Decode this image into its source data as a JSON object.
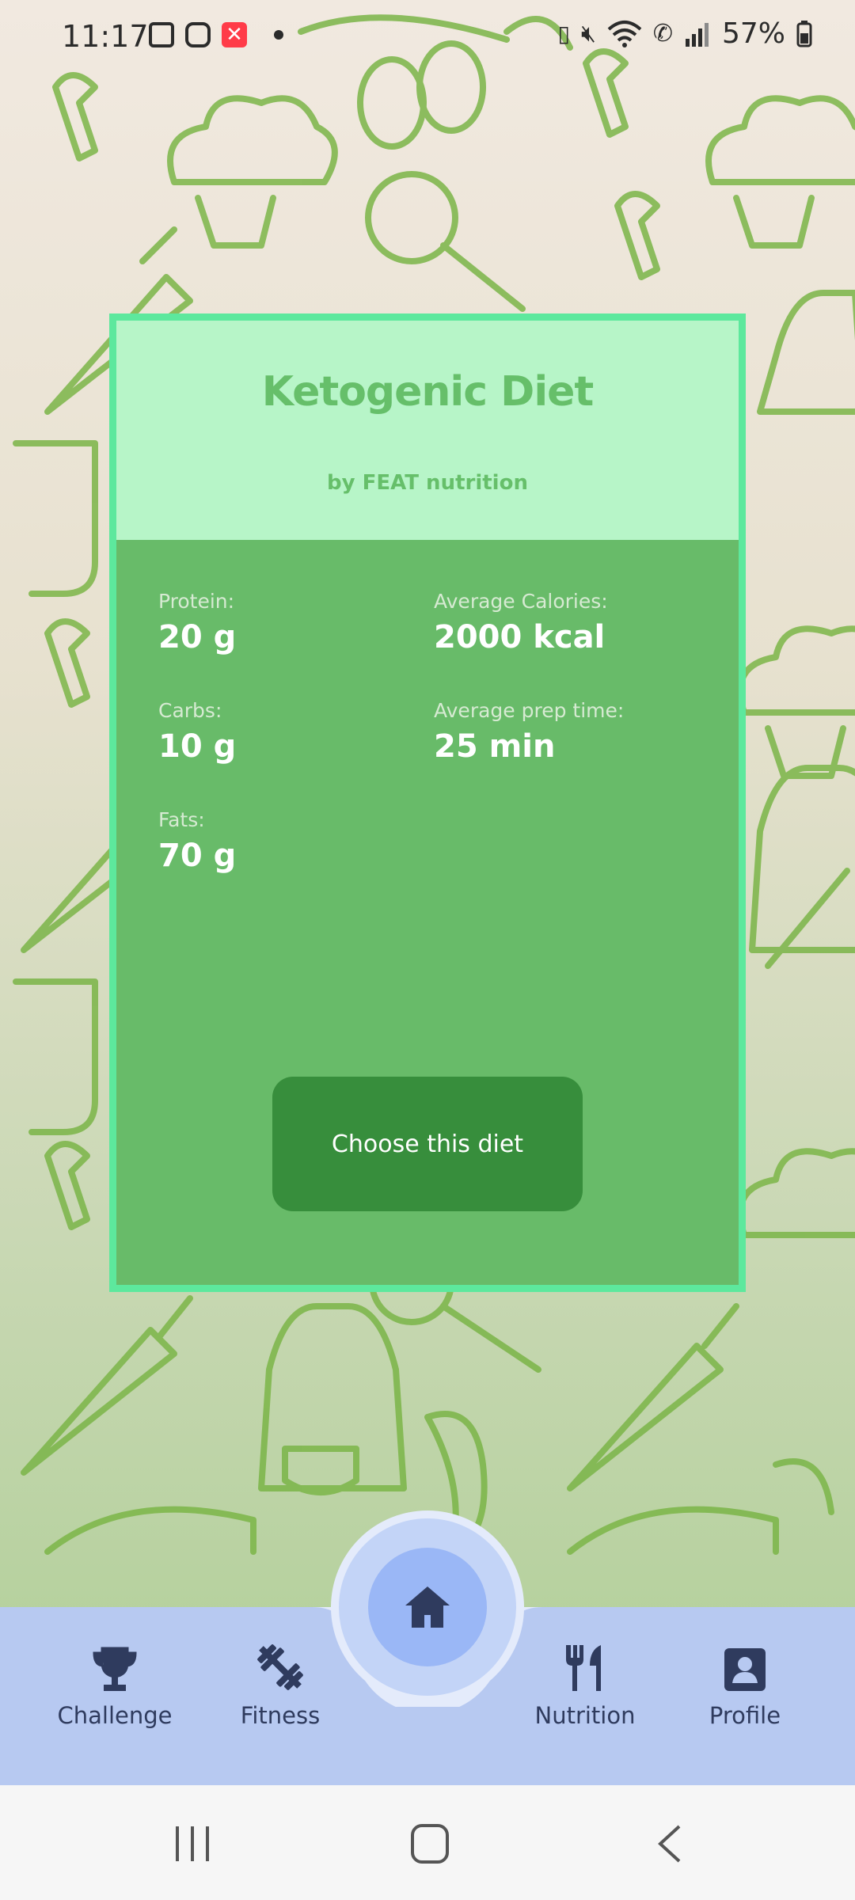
{
  "status_bar": {
    "time": "11:17",
    "battery": "57%",
    "icons": [
      "image-icon",
      "instagram-icon",
      "blocked-app-icon",
      "dot-icon",
      "battery-saver-icon",
      "mute-icon",
      "wifi-icon",
      "wifi-call-icon",
      "signal-icon",
      "battery-icon"
    ]
  },
  "card": {
    "title": "Ketogenic Diet",
    "subtitle": "by FEAT nutrition",
    "stats": [
      {
        "label": "Protein:",
        "value": "20 g"
      },
      {
        "label": "Average Calories:",
        "value": "2000 kcal"
      },
      {
        "label": "Carbs:",
        "value": "10 g"
      },
      {
        "label": "Average prep time:",
        "value": "25 min"
      },
      {
        "label": "Fats:",
        "value": "70 g"
      }
    ],
    "button_label": "Choose this diet"
  },
  "bottom_nav": {
    "items": [
      {
        "label": "Challenge",
        "icon": "trophy-icon"
      },
      {
        "label": "Fitness",
        "icon": "dumbbell-icon"
      },
      {
        "label": "Nutrition",
        "icon": "utensils-icon"
      },
      {
        "label": "Profile",
        "icon": "profile-icon"
      }
    ],
    "center_icon": "home-icon"
  },
  "system_nav": [
    "recent-apps-icon",
    "home-button-icon",
    "back-icon"
  ],
  "colors": {
    "card_border": "#5de89d",
    "card_header": "#b7f5c8",
    "card_body": "#68bb69",
    "button": "#378e3c",
    "nav_bg": "#b7c9f1"
  }
}
